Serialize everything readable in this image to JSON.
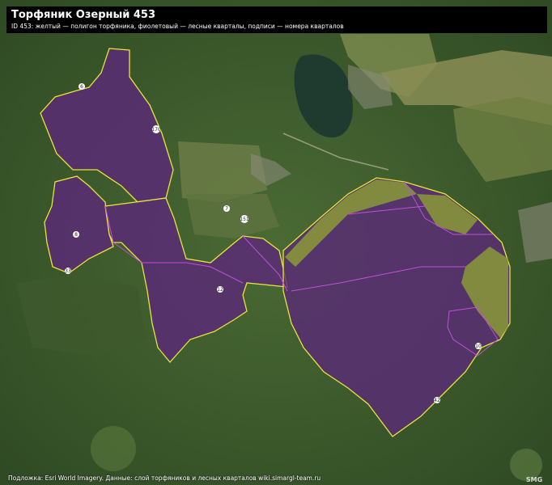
{
  "header": {
    "title": "Торфяник Озерный 453",
    "subtitle": "ID 453: желтый — полигон торфяника, фиолетовый — лесные кварталы, подписи — номера кварталов"
  },
  "footer": {
    "attribution": "Подложка: Esri World Imagery. Данные: слой торфяников и лесных кварталов wiki.simargl-team.ru"
  },
  "legend_colors": {
    "peat_polygon": "#e8e43a",
    "forest_quarters": "#b040c8",
    "peat_fill": "#5a2a78"
  },
  "quarters": [
    {
      "id": "q-6",
      "label": "6"
    },
    {
      "id": "q-170",
      "label": "170"
    },
    {
      "id": "q-8",
      "label": "8"
    },
    {
      "id": "q-33",
      "label": "33"
    },
    {
      "id": "q-7",
      "label": "7"
    },
    {
      "id": "q-151",
      "label": "151"
    },
    {
      "id": "q-12",
      "label": "12"
    },
    {
      "id": "q-10",
      "label": "10"
    },
    {
      "id": "q-42",
      "label": "42"
    }
  ],
  "watermark": "SMG"
}
